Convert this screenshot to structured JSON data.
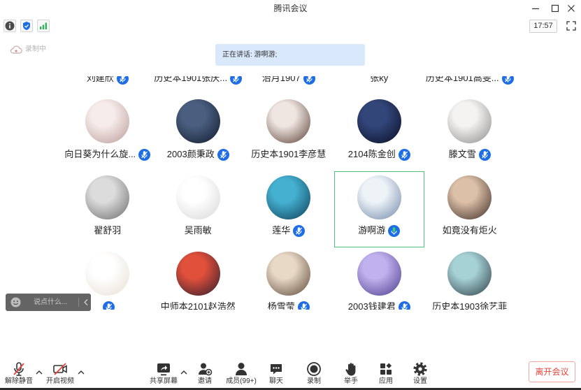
{
  "window": {
    "title": "腾讯会议",
    "controls": [
      "minimize-icon",
      "maximize-icon",
      "close-icon"
    ]
  },
  "info_bar": {
    "icons": [
      "info-icon",
      "shield-icon",
      "signal-icon"
    ],
    "time": "17:57"
  },
  "recording": {
    "label": "录制中",
    "icon": "cloud-icon"
  },
  "speaking_banner": {
    "text": "正在讲话: 游啊游;"
  },
  "participants": [
    {
      "name": "刘建欣",
      "mic": "muted",
      "active": false,
      "avatar": [
        "#d9cfc8",
        "#6d5a50"
      ]
    },
    {
      "name": "历史本1901张庆...",
      "mic": "muted",
      "active": false,
      "avatar": [
        "#cfd8e0",
        "#4b5b6b"
      ]
    },
    {
      "name": "治月1907",
      "mic": "muted",
      "active": false,
      "avatar": [
        "#e0d6cc",
        "#5a4a40"
      ]
    },
    {
      "name": "张ky",
      "mic": "none",
      "active": false,
      "avatar": [
        "#d5d5d5",
        "#555555"
      ]
    },
    {
      "name": "历史本1901高雯...",
      "mic": "muted",
      "active": false,
      "avatar": [
        "#e8dcd4",
        "#7a6458"
      ]
    },
    {
      "name": "向日葵为什么旋...",
      "mic": "muted",
      "active": false,
      "avatar": [
        "#f6ecea",
        "#b89a98"
      ]
    },
    {
      "name": "2003颜秉政",
      "mic": "muted",
      "active": false,
      "avatar": [
        "#4a5f80",
        "#0f1a2b"
      ]
    },
    {
      "name": "历史本1901李彦慧",
      "mic": "none",
      "active": false,
      "avatar": [
        "#efe6e2",
        "#5a3d33"
      ]
    },
    {
      "name": "2104陈金创",
      "mic": "muted",
      "active": false,
      "avatar": [
        "#33467a",
        "#080e22"
      ]
    },
    {
      "name": "滕文雪",
      "mic": "muted",
      "active": false,
      "avatar": [
        "#f4f3f2",
        "#8d8a88"
      ]
    },
    {
      "name": "翟舒羽",
      "mic": "none",
      "active": false,
      "avatar": [
        "#dcdcdc",
        "#6a6a6a"
      ]
    },
    {
      "name": "吴雨敏",
      "mic": "none",
      "active": false,
      "avatar": [
        "#ffffff",
        "#d6d6d6"
      ]
    },
    {
      "name": "莲华",
      "mic": "muted",
      "active": false,
      "avatar": [
        "#45b0d0",
        "#0c3d56"
      ]
    },
    {
      "name": "游啊游",
      "mic": "speaking",
      "active": true,
      "avatar": [
        "#eef3f8",
        "#6f86a8"
      ]
    },
    {
      "name": "如竟没有炬火",
      "mic": "none",
      "active": false,
      "avatar": [
        "#dcc0a8",
        "#3b2a22"
      ]
    },
    {
      "name": "",
      "mic": "muted",
      "active": false,
      "avatar": [
        "#ffffff",
        "#e6ded2"
      ]
    },
    {
      "name": "中师本2101赵浩然",
      "mic": "none",
      "active": false,
      "avatar": [
        "#e0503a",
        "#2a1c2e"
      ]
    },
    {
      "name": "杨雪莹",
      "mic": "muted",
      "active": false,
      "avatar": [
        "#e8d8c6",
        "#5b4636"
      ]
    },
    {
      "name": "2003钱建君",
      "mic": "muted",
      "active": false,
      "avatar": [
        "#c0b2ee",
        "#4c3a8a"
      ]
    },
    {
      "name": "历史本1903徐艺菲",
      "mic": "none",
      "active": false,
      "avatar": [
        "#a6d2d6",
        "#2b3b44"
      ]
    }
  ],
  "chat": {
    "placeholder": "说点什么..."
  },
  "toolbar": {
    "unmute": "解除静音",
    "start_video": "开启视频",
    "share_screen": "共享屏幕",
    "invite": "邀请",
    "members": "成员(99+)",
    "chat": "聊天",
    "record": "录制",
    "raise_hand": "举手",
    "apps": "应用",
    "settings": "设置",
    "leave": "离开会议"
  },
  "colors": {
    "accent": "#1d6ee6",
    "speaking_border": "#4cc27e",
    "speaking_mic": "#3ecf6e",
    "leave_red": "#e5433d",
    "banner_bg": "#d9e8fb",
    "mute_slash": "#e5433d"
  }
}
